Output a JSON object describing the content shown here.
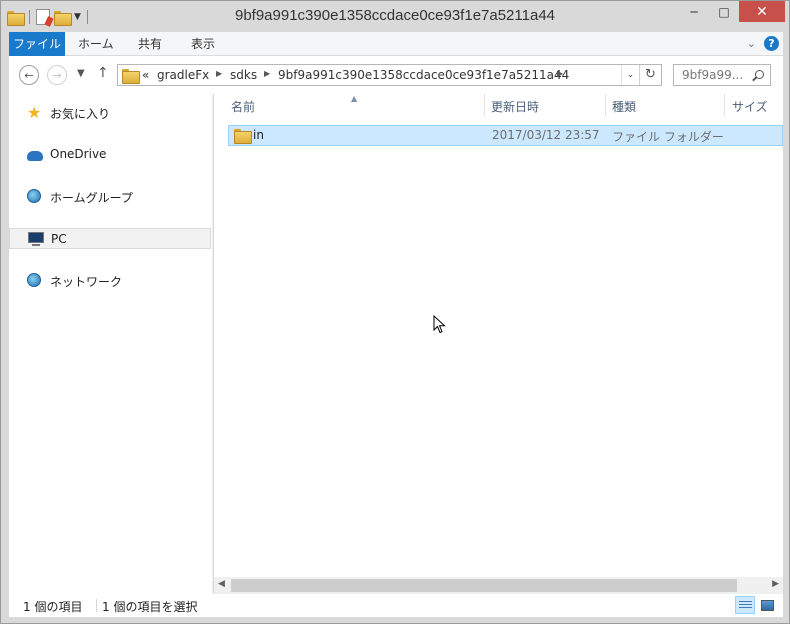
{
  "window": {
    "title": "9bf9a991c390e1358ccdace0ce93f1e7a5211a44",
    "minimize_glyph": "─",
    "maximize_glyph": "□",
    "close_glyph": "✕"
  },
  "ribbon": {
    "tabs": [
      "ファイル",
      "ホーム",
      "共有",
      "表示"
    ]
  },
  "address_bar": {
    "prefix": "«",
    "crumbs": [
      "gradleFx",
      "sdks",
      "9bf9a991c390e1358ccdace0ce93f1e7a5211a44"
    ]
  },
  "search": {
    "placeholder": "9bf9a99..."
  },
  "nav_pane": {
    "items": [
      {
        "label": "お気に入り",
        "icon": "star-icon"
      },
      {
        "label": "OneDrive",
        "icon": "cloud-icon"
      },
      {
        "label": "ホームグループ",
        "icon": "homegroup-icon"
      },
      {
        "label": "PC",
        "icon": "computer-icon",
        "selected": true
      },
      {
        "label": "ネットワーク",
        "icon": "network-icon"
      }
    ]
  },
  "file_list": {
    "columns": [
      "名前",
      "更新日時",
      "種類",
      "サイズ"
    ],
    "rows": [
      {
        "name": "in",
        "modified": "2017/03/12 23:57",
        "type": "ファイル フォルダー",
        "size": "",
        "selected": true
      }
    ]
  },
  "status_bar": {
    "item_count": "1 個の項目",
    "selection": "1 個の項目を選択"
  },
  "colors": {
    "accent": "#1979ca",
    "selection_bg": "#cce8ff",
    "selection_border": "#99d1ff"
  }
}
